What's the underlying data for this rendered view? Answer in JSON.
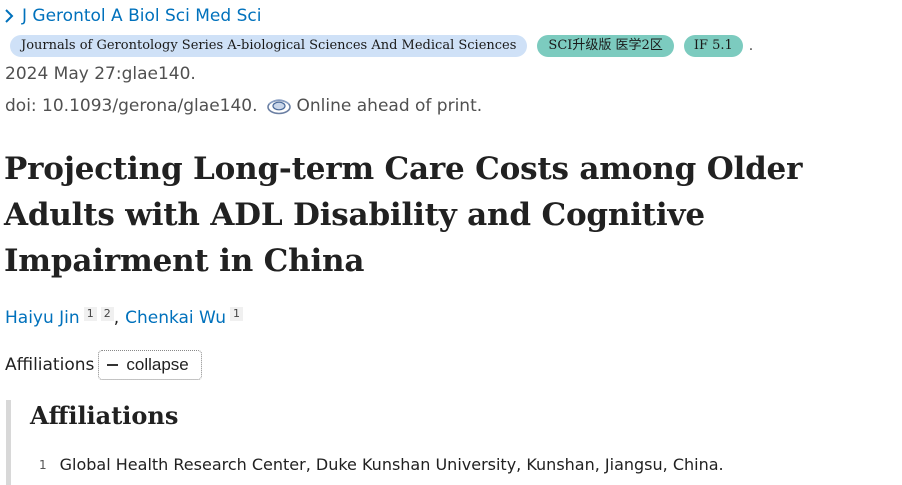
{
  "journal": {
    "link_text": "J Gerontol A Biol Sci Med Sci"
  },
  "badges": {
    "journal_full": "Journals of Gerontology Series A-biological Sciences And Medical Sciences",
    "rank": "SCI升级版 医学2区",
    "impact": "IF 5.1",
    "trailing": "."
  },
  "citation": {
    "date_line": "2024 May 27:glae140.",
    "doi_line": "doi: 10.1093/gerona/glae140.",
    "status": "Online ahead of print."
  },
  "article": {
    "title": "Projecting Long-term Care Costs among Older Adults with ADL Disability and Cognitive Impairment in China"
  },
  "authors": [
    {
      "name": "Haiyu Jin",
      "affiliations": [
        "1",
        "2"
      ]
    },
    {
      "name": "Chenkai Wu",
      "affiliations": [
        "1"
      ]
    }
  ],
  "author_separator": ",",
  "affiliations_toggle": {
    "label": "Affiliations",
    "button_label": "collapse"
  },
  "affiliations_panel": {
    "heading": "Affiliations",
    "items": [
      {
        "number": "1",
        "text": "Global Health Research Center, Duke Kunshan University, Kunshan, Jiangsu, China."
      }
    ]
  }
}
